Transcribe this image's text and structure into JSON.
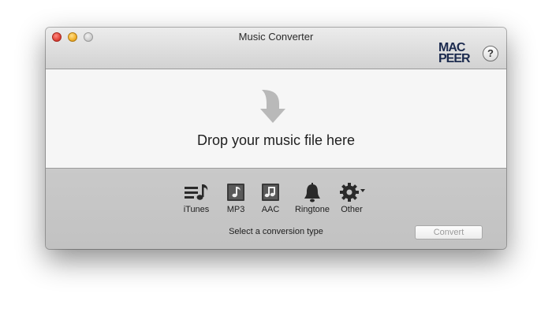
{
  "window": {
    "title": "Music Converter",
    "logo_text": [
      "MAC",
      "PEER"
    ],
    "help_label": "?"
  },
  "dropzone": {
    "message": "Drop your music file here",
    "icon": "down-arrow-icon"
  },
  "conversion_types": [
    {
      "label": "iTunes",
      "icon": "itunes-playlist-icon"
    },
    {
      "label": "MP3",
      "icon": "mp3-note-icon"
    },
    {
      "label": "AAC",
      "icon": "aac-note-icon"
    },
    {
      "label": "Ringtone",
      "icon": "bell-icon"
    },
    {
      "label": "Other",
      "icon": "gear-icon"
    }
  ],
  "footer": {
    "status": "Select a conversion type",
    "convert_label": "Convert",
    "convert_enabled": false
  },
  "colors": {
    "logo": "#1b2a4e",
    "close": "#e0443a",
    "minimize": "#f2b02a",
    "zoom": "#cfcfcf"
  }
}
